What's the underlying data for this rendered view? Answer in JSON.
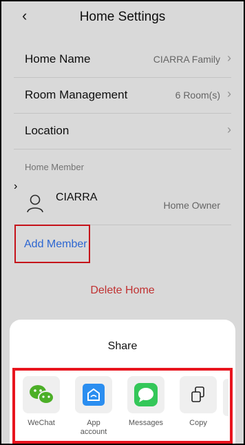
{
  "header": {
    "back_icon": "chevron-left-icon",
    "title": "Home Settings"
  },
  "settings": {
    "home_name": {
      "label": "Home Name",
      "value": "CIARRA Family"
    },
    "room_management": {
      "label": "Room Management",
      "value": "6 Room(s)"
    },
    "location": {
      "label": "Location"
    }
  },
  "members": {
    "section_label": "Home Member",
    "items": [
      {
        "name": "CIARRA",
        "role": "Home Owner",
        "icon": "user-icon"
      }
    ],
    "add_label": "Add Member"
  },
  "delete_label": "Delete Home",
  "share": {
    "title": "Share",
    "options": [
      {
        "label": "WeChat",
        "icon": "wechat-icon",
        "color": "#4caf27"
      },
      {
        "label": "App\naccount",
        "icon": "home-app-icon",
        "color": "#2b8ef0"
      },
      {
        "label": "Messages",
        "icon": "messages-icon",
        "color": "#34c759"
      },
      {
        "label": "Copy",
        "icon": "copy-icon",
        "color": "#222222"
      }
    ]
  },
  "colors": {
    "accent_blue": "#3478f6",
    "danger_red": "#e23a3a",
    "highlight_red": "#e8141e"
  }
}
